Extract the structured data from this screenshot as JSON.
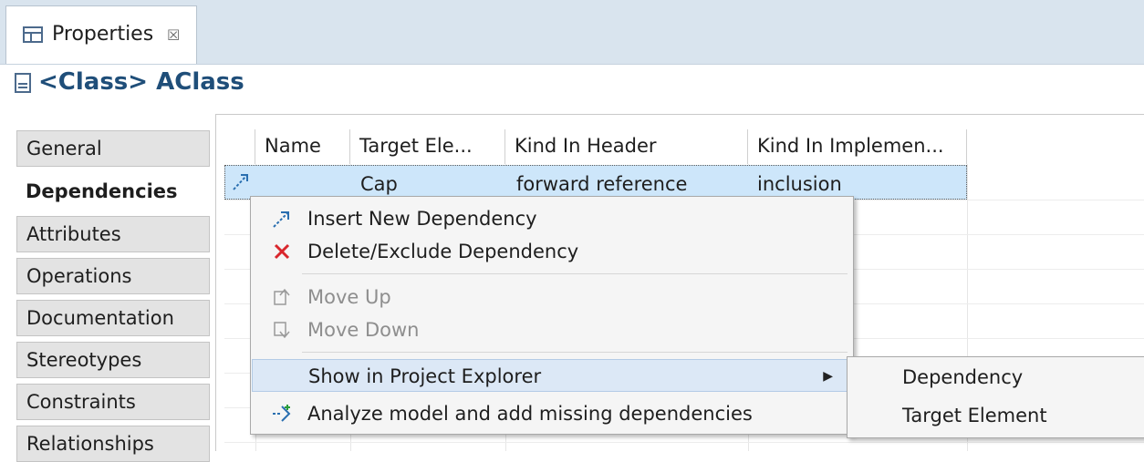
{
  "tab": {
    "label": "Properties",
    "close": "☒"
  },
  "header": {
    "title": "<Class> AClass"
  },
  "sidebar": {
    "items": [
      {
        "label": "General"
      },
      {
        "label": "Dependencies"
      },
      {
        "label": "Attributes"
      },
      {
        "label": "Operations"
      },
      {
        "label": "Documentation"
      },
      {
        "label": "Stereotypes"
      },
      {
        "label": "Constraints"
      },
      {
        "label": "Relationships"
      }
    ]
  },
  "table": {
    "columns": [
      "Name",
      "Target Ele...",
      "Kind In Header",
      "Kind In Implemen..."
    ],
    "rows": [
      {
        "name": "",
        "target": "Cap",
        "kind_header": "forward reference",
        "kind_impl": "inclusion"
      }
    ]
  },
  "context_menu": {
    "items": [
      {
        "label": "Insert New Dependency",
        "icon": "dependency-icon"
      },
      {
        "label": "Delete/Exclude Dependency",
        "icon": "delete-icon"
      },
      {
        "label": "Move Up",
        "icon": "move-up-icon",
        "disabled": true
      },
      {
        "label": "Move Down",
        "icon": "move-down-icon",
        "disabled": true
      },
      {
        "label": "Show in Project Explorer",
        "submenu": true
      },
      {
        "label": "Analyze model and add missing dependencies",
        "icon": "analyze-icon"
      }
    ]
  },
  "submenu": {
    "items": [
      {
        "label": "Dependency"
      },
      {
        "label": "Target Element"
      }
    ]
  },
  "colors": {
    "accent": "#1f4e79",
    "selection": "#cde6fa",
    "delete": "#d9262c"
  }
}
